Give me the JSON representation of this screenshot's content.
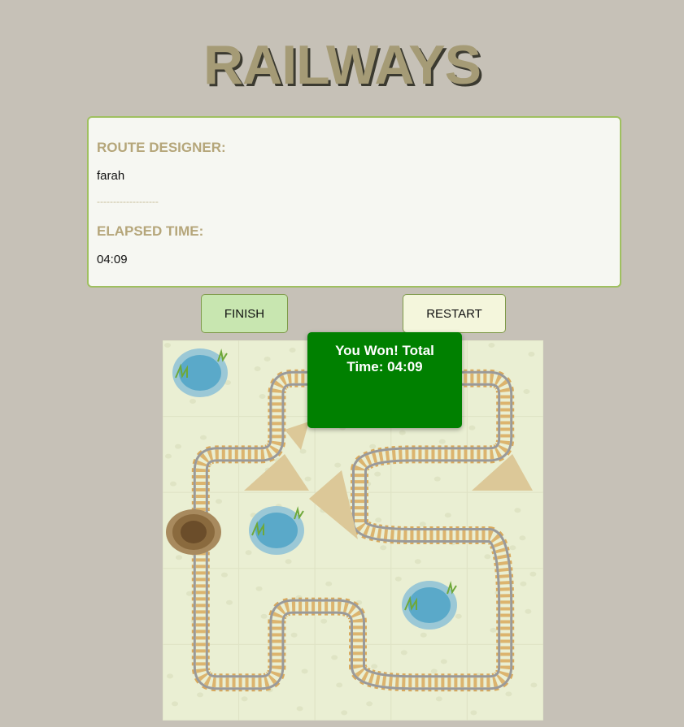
{
  "header": {
    "title": "RAILWAYS"
  },
  "info_panel": {
    "designer_label": "ROUTE DESIGNER:",
    "designer_name": "farah",
    "separator": "-------------------",
    "time_label": "ELAPSED TIME:",
    "time_value": "04:09"
  },
  "buttons": {
    "finish_label": "FINISH",
    "restart_label": "RESTART"
  },
  "win_popup": {
    "message": "You Won! Total Time: 04:09"
  },
  "board": {
    "rows": 5,
    "cols": 5,
    "tiles": [
      [
        "oasis",
        "curve",
        "curve",
        "curve",
        "curve"
      ],
      [
        "curve",
        "curve",
        "dunes",
        "curve",
        "curve"
      ],
      [
        "straight",
        "oasis",
        "curve",
        "straight",
        "curve"
      ],
      [
        "straight",
        "curve",
        "curve",
        "oasis",
        "straight"
      ],
      [
        "curve",
        "curve",
        "curve",
        "curve",
        "curve"
      ]
    ],
    "colors": {
      "ground": "#eaefd3",
      "rail": "#9a9a9a",
      "sleeper": "#d9a95c",
      "water": "#5aa9c9",
      "mountain": "#6b4d2a",
      "sand": "#dcc898"
    }
  }
}
